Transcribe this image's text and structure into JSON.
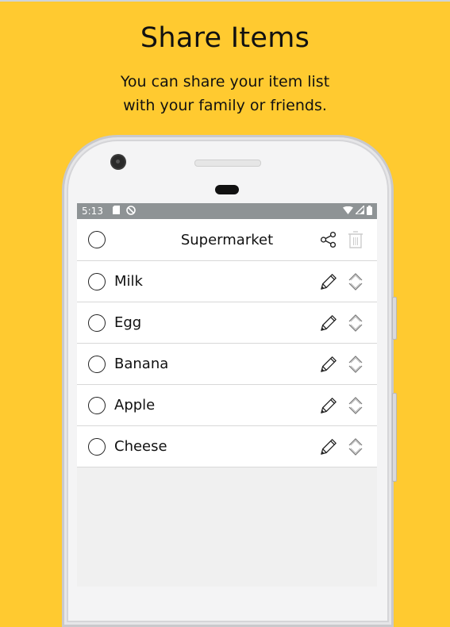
{
  "promo": {
    "title": "Share Items",
    "subtitle_line1": "You can share your item list",
    "subtitle_line2": "with your family or friends."
  },
  "statusbar": {
    "time": "5:13",
    "left_icons": [
      "sd-card-icon",
      "do-not-disturb-icon"
    ],
    "right_icons": [
      "wifi-icon",
      "cell-signal-icon",
      "battery-icon"
    ]
  },
  "list": {
    "name": "Supermarket",
    "header_actions": [
      "share-icon",
      "trash-icon"
    ],
    "items": [
      {
        "label": "Milk"
      },
      {
        "label": "Egg"
      },
      {
        "label": "Banana"
      },
      {
        "label": "Apple"
      },
      {
        "label": "Cheese"
      }
    ]
  },
  "colors": {
    "background": "#FFCA30",
    "statusbar": "#8E9395"
  }
}
